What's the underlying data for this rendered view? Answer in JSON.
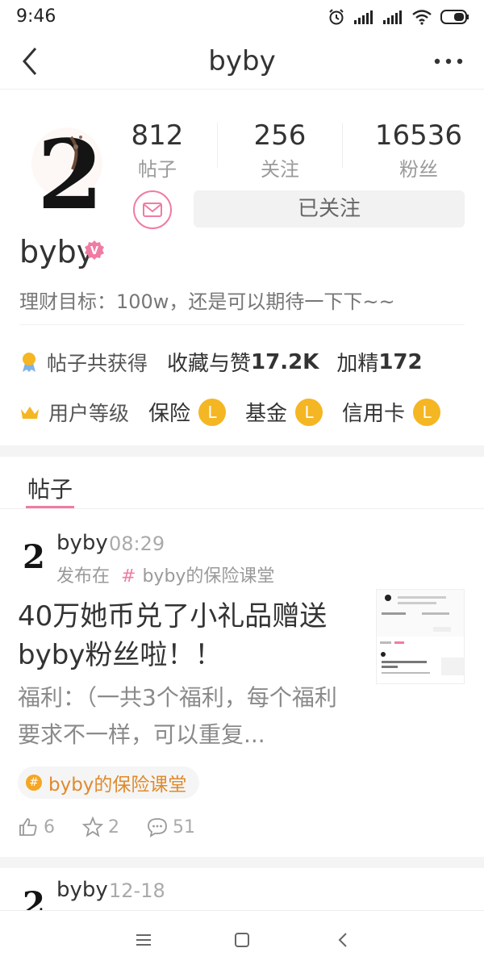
{
  "status_bar": {
    "time": "9:46"
  },
  "nav": {
    "title": "byby"
  },
  "profile": {
    "stats": [
      {
        "value": "812",
        "label": "帖子"
      },
      {
        "value": "256",
        "label": "关注"
      },
      {
        "value": "16536",
        "label": "粉丝"
      }
    ],
    "follow_label": "已关注",
    "username": "byby",
    "bio": "理财目标：100w，还是可以期待一下下~~",
    "achievements": {
      "label": "帖子共获得",
      "likes_label": "收藏与赞",
      "likes_value": "17.2K",
      "featured_label": "加精",
      "featured_value": "172"
    },
    "levels": {
      "label": "用户等级",
      "items": [
        {
          "name": "保险",
          "badge": "L"
        },
        {
          "name": "基金",
          "badge": "L"
        },
        {
          "name": "信用卡",
          "badge": "L"
        }
      ]
    }
  },
  "tabs": {
    "active": "帖子"
  },
  "posts": [
    {
      "author": "byby",
      "time": "08:29",
      "posted_in_label": "发布在",
      "hash_symbol": "#",
      "topic": "byby的保险课堂",
      "title": "40万她币兑了小礼品赠送byby粉丝啦！！",
      "excerpt": "福利：（一共3个福利，每个福利要求不一样，可以重复...",
      "tag": "byby的保险课堂",
      "likes": "6",
      "favorites": "2",
      "comments": "51"
    },
    {
      "author": "byby",
      "time": "12-18"
    }
  ],
  "colors": {
    "accent": "#f07ca4",
    "level": "#f5b623",
    "tag_text": "#e08a2c"
  }
}
